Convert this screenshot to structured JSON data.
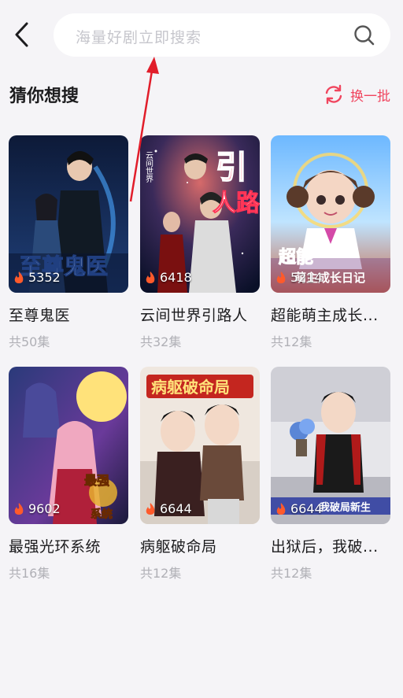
{
  "header": {
    "back_icon": "chevron-left-icon",
    "search_placeholder": "海量好剧立即搜索",
    "search_icon": "search-icon"
  },
  "section": {
    "title": "猜你想搜",
    "refresh_label": "换一批",
    "refresh_icon": "refresh-icon",
    "accent_color": "#f0455e"
  },
  "dramas": [
    {
      "title": "至尊鬼医",
      "views": "5352",
      "episodes": "共50集",
      "cover_overlay_text": "至尊鬼医"
    },
    {
      "title": "云间世界引路人",
      "views": "6418",
      "episodes": "共32集",
      "cover_overlay_text": "引路人"
    },
    {
      "title": "超能萌主成长日记",
      "display_title": "超能萌主成长...",
      "views": "5214",
      "episodes": "共12集",
      "cover_overlay_text": "超能萌主成长日记"
    },
    {
      "title": "最强光环系统",
      "views": "9602",
      "episodes": "共16集",
      "cover_overlay_text": "最强光环系统"
    },
    {
      "title": "病躯破命局",
      "views": "6644",
      "episodes": "共12集",
      "cover_overlay_text": "病躯破命局"
    },
    {
      "title": "出狱后，我破局新生",
      "display_title": "出狱后，我破...",
      "views": "6644",
      "episodes": "共12集",
      "cover_overlay_text": "我破局新生"
    }
  ]
}
